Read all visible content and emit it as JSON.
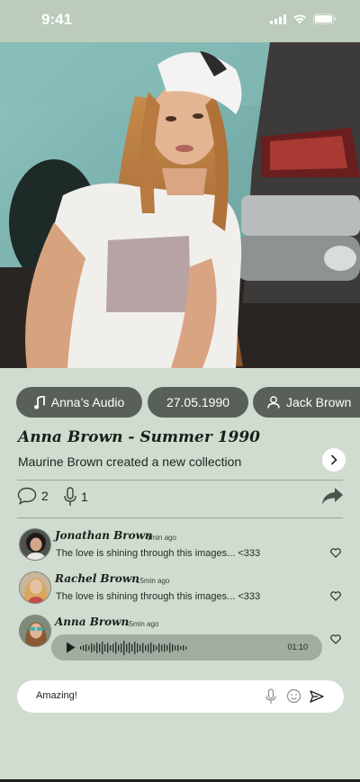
{
  "status_bar": {
    "time": "9:41"
  },
  "chips": {
    "audio": {
      "label": "Anna’s Audio",
      "icon": "music-note-icon"
    },
    "date": {
      "label": "27.05.1990"
    },
    "user": {
      "label": "Jack Brown",
      "icon": "user-icon"
    }
  },
  "post": {
    "title": "Anna Brown - Summer 1990",
    "subtitle": "Maurine Brown created a new collection",
    "comment_count": "2",
    "audio_count": "1"
  },
  "comments": [
    {
      "name": "Jonathan Brown",
      "time": "1min ago",
      "text": "The love is shining through this images... <333"
    },
    {
      "name": "Rachel Brown",
      "time": "15min ago",
      "text": "The love is shining through this images... <333"
    },
    {
      "name": "Anna Brown",
      "time": "45min ago",
      "audio_duration": "01:10"
    }
  ],
  "composer": {
    "value": "Amazing!"
  },
  "colors": {
    "background": "#cfdccf",
    "chip": "#596059",
    "audio_bubble": "#a2ada2",
    "status_bar": "#bccbbc"
  }
}
